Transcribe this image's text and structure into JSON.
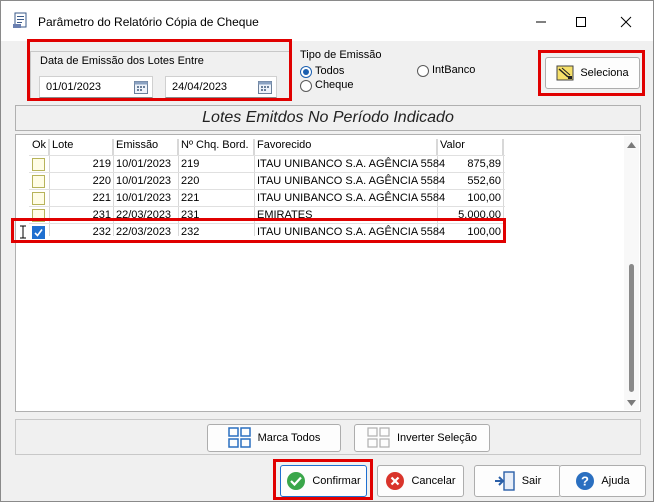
{
  "window": {
    "title": "Parâmetro do Relatório Cópia de Cheque"
  },
  "date_group": {
    "label": "Data de Emissão dos Lotes Entre",
    "start_date": "01/01/2023",
    "end_date": "24/04/2023"
  },
  "tipo_emissao": {
    "label": "Tipo de Emissão",
    "options": [
      {
        "label": "Todos",
        "selected": true
      },
      {
        "label": "IntBanco",
        "selected": false
      },
      {
        "label": "Cheque",
        "selected": false
      }
    ]
  },
  "seleciona_button": "Seleciona",
  "section_title": "Lotes Emitdos No Período Indicado",
  "table": {
    "headers": [
      "Ok",
      "Lote",
      "Emissão",
      "Nº Chq. Bord.",
      "Favorecido",
      "Valor"
    ],
    "rows": [
      {
        "ok": false,
        "lote": "219",
        "emissao": "10/01/2023",
        "chq": "219",
        "favorecido": "ITAU UNIBANCO S.A. AGÊNCIA 5584",
        "valor": "875,89"
      },
      {
        "ok": false,
        "lote": "220",
        "emissao": "10/01/2023",
        "chq": "220",
        "favorecido": "ITAU UNIBANCO S.A. AGÊNCIA 5584",
        "valor": "552,60"
      },
      {
        "ok": false,
        "lote": "221",
        "emissao": "10/01/2023",
        "chq": "221",
        "favorecido": "ITAU UNIBANCO S.A. AGÊNCIA 5584",
        "valor": "100,00"
      },
      {
        "ok": false,
        "lote": "231",
        "emissao": "22/03/2023",
        "chq": "231",
        "favorecido": "EMIRATES",
        "valor": "5.000,00"
      },
      {
        "ok": true,
        "lote": "232",
        "emissao": "22/03/2023",
        "chq": "232",
        "favorecido": "ITAU UNIBANCO S.A. AGÊNCIA 5584",
        "valor": "100,00"
      }
    ]
  },
  "marca_todos_button": "Marca Todos",
  "inverter_button": "Inverter Seleção",
  "bottom_buttons": {
    "confirmar": "Confirmar",
    "cancelar": "Cancelar",
    "sair": "Sair",
    "ajuda": "Ajuda"
  },
  "colors": {
    "highlight": "#e00000",
    "accent": "#1e6fd0"
  }
}
